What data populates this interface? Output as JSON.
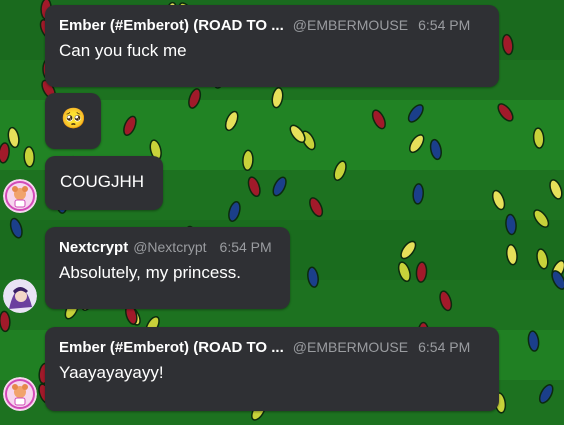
{
  "messages": [
    {
      "name": "Ember (#Emberot) (ROAD TO ...",
      "handle": "@EMBERMOUSE",
      "time": "6:54 PM",
      "text": "Can you fuck me"
    },
    {
      "text": "🥺",
      "emoji_name": "pleading-face-icon"
    },
    {
      "text": "COUGJHH"
    },
    {
      "name": "Nextcrypt",
      "handle": "@Nextcrypt",
      "time": "6:54 PM",
      "text": "Absolutely, my princess."
    },
    {
      "name": "Ember (#Emberot) (ROAD TO ...",
      "handle": "@EMBERMOUSE",
      "time": "6:54 PM",
      "text": "Yaayayayayy!"
    }
  ],
  "colors": {
    "bubble": "#2f3034",
    "meta": "#9a9ca0",
    "background": "#1f7a22"
  },
  "avatars": [
    "ember-avatar",
    "nextcrypt-avatar",
    "ember-avatar"
  ]
}
